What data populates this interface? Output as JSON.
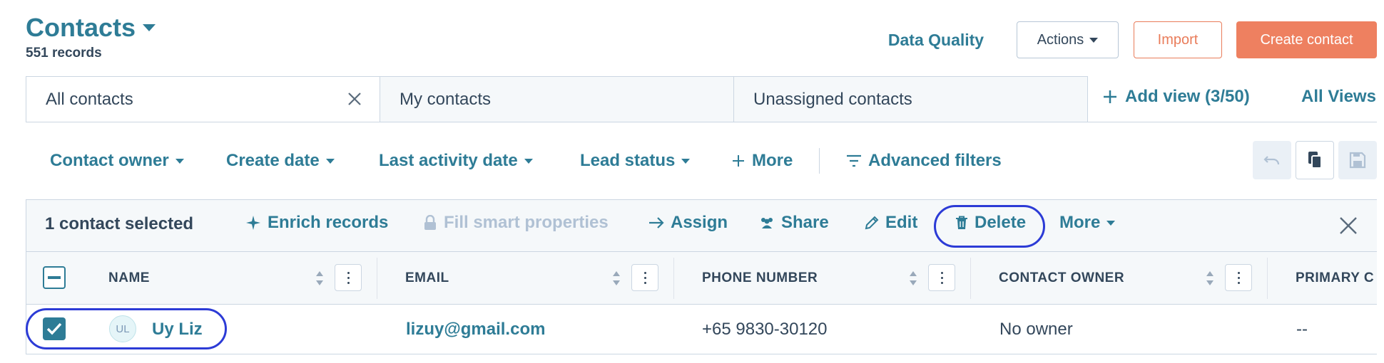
{
  "header": {
    "title": "Contacts",
    "record_count": "551 records",
    "data_quality": "Data Quality",
    "actions": "Actions",
    "import": "Import",
    "create": "Create contact"
  },
  "tabs": [
    {
      "label": "All contacts",
      "active": true
    },
    {
      "label": "My contacts",
      "active": false
    },
    {
      "label": "Unassigned contacts",
      "active": false
    }
  ],
  "views": {
    "add_view": "Add view (3/50)",
    "all_views": "All Views"
  },
  "filters": {
    "contact_owner": "Contact owner",
    "create_date": "Create date",
    "last_activity_date": "Last activity date",
    "lead_status": "Lead status",
    "more": "More",
    "advanced": "Advanced filters"
  },
  "bulk": {
    "selected": "1 contact selected",
    "enrich": "Enrich records",
    "fill_smart": "Fill smart properties",
    "assign": "Assign",
    "share": "Share",
    "edit": "Edit",
    "delete": "Delete",
    "more": "More"
  },
  "columns": {
    "name": "NAME",
    "email": "EMAIL",
    "phone": "PHONE NUMBER",
    "owner": "CONTACT OWNER",
    "primary": "PRIMARY C"
  },
  "rows": [
    {
      "initials": "UL",
      "name": "Uy Liz",
      "email": "lizuy@gmail.com",
      "phone": "+65 9830-30120",
      "owner": "No owner",
      "primary": "--",
      "selected": true
    }
  ],
  "colors": {
    "accent": "#2e7c96",
    "primary_button": "#ee8060",
    "highlight_ring": "#2c3bd6"
  }
}
